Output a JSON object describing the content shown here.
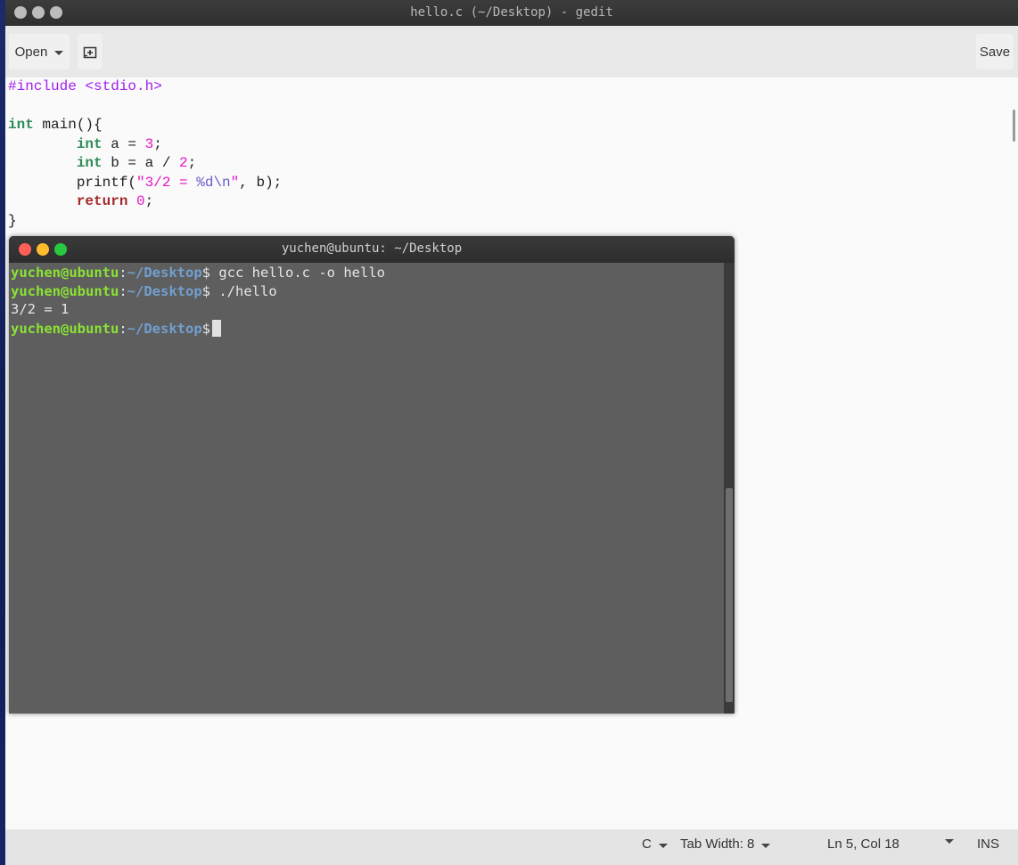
{
  "gedit": {
    "title": "hello.c (~/Desktop) - gedit",
    "toolbar": {
      "open_label": "Open",
      "save_label": "Save"
    },
    "code": {
      "line1": {
        "pp": "#include <stdio.h>"
      },
      "line3": {
        "kw": "int",
        "rest": " main(){"
      },
      "line4": {
        "indent": "        ",
        "kw": "int",
        "mid": " a = ",
        "num": "3",
        "end": ";"
      },
      "line5": {
        "indent": "        ",
        "kw": "int",
        "mid": " b = a / ",
        "num": "2",
        "end": ";"
      },
      "line6": {
        "indent": "        ",
        "fn": "printf(",
        "str1": "\"3/2 = ",
        "esc1": "%d",
        "esc2": "\\n",
        "str2": "\"",
        "rest": ", b);"
      },
      "line7": {
        "indent": "        ",
        "kw": "return",
        "sp": " ",
        "num": "0",
        "end": ";"
      },
      "line8": {
        "text": "}"
      }
    },
    "statusbar": {
      "language": "C",
      "tab_width": "Tab Width: 8",
      "position": "Ln 5, Col 18",
      "mode": "INS"
    }
  },
  "terminal": {
    "title": "yuchen@ubuntu: ~/Desktop",
    "prompt_user": "yuchen@ubuntu",
    "prompt_colon": ":",
    "prompt_path": "~/Desktop",
    "prompt_dollar": "$",
    "cmd1": " gcc hello.c -o hello",
    "cmd2": " ./hello",
    "output1": "3/2 = 1"
  },
  "colors": {
    "prompt_user": "#8ae234",
    "prompt_path": "#729fcf",
    "keyword": "#2e8b57",
    "return_keyword": "#a52a2a",
    "preprocessor": "#a020f0",
    "string": "#e815c5",
    "close": "#ff5f57",
    "minimize": "#febc2e",
    "maximize": "#28c840"
  }
}
